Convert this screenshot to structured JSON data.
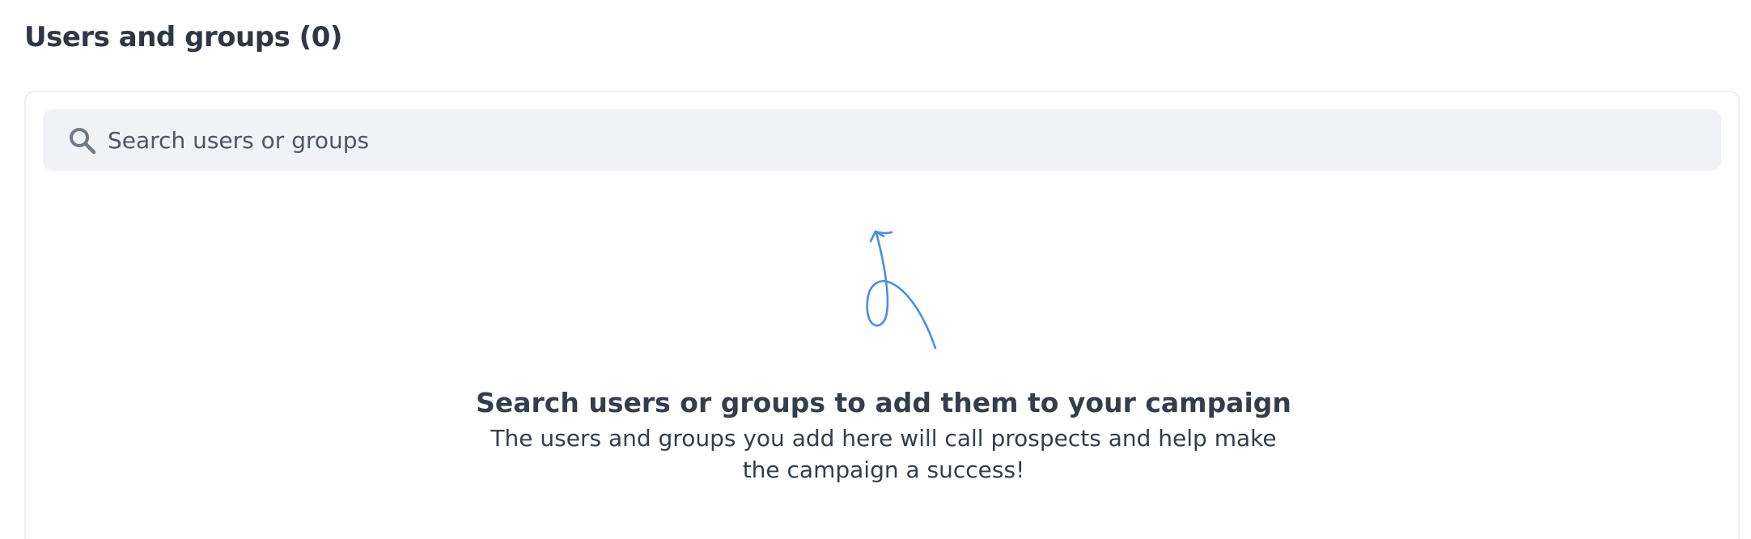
{
  "section": {
    "title": "Users and groups (0)"
  },
  "search": {
    "placeholder": "Search users or groups",
    "value": "",
    "icon": "search-icon"
  },
  "empty_state": {
    "icon": "curly-arrow-up-icon",
    "title": "Search users or groups to add them to your campaign",
    "description": "The users and groups you add here will call prospects and help make the campaign a success!"
  },
  "colors": {
    "accent_arrow": "#4a8fe0",
    "search_bg": "#f0f2f5",
    "panel_border": "#edf0f3",
    "text_primary": "#333d4b",
    "icon_gray": "#6f7a8a"
  }
}
